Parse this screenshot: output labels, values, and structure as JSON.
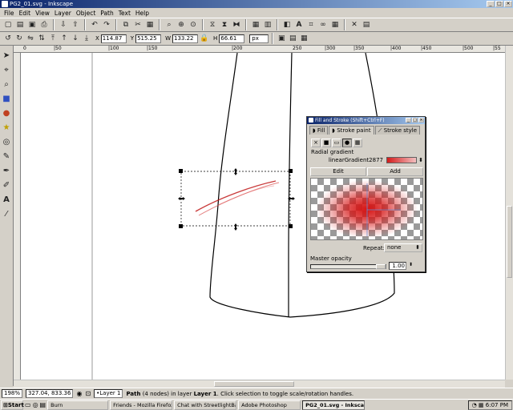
{
  "window": {
    "title": "PG2_01.svg - Inkscape"
  },
  "menu": [
    "File",
    "Edit",
    "View",
    "Layer",
    "Object",
    "Path",
    "Text",
    "Help"
  ],
  "toolbar": {
    "x_label": "X",
    "x_value": "114.87",
    "y_label": "Y",
    "y_value": "515.25",
    "w_label": "W",
    "w_value": "133.22",
    "h_label": "H",
    "h_value": "66.61",
    "unit": "px"
  },
  "ruler": {
    "h_marks": [
      "0",
      "|50",
      "|100",
      "|150",
      "|200",
      "250",
      "|300",
      "|350",
      "|400",
      "|450",
      "|500",
      "|55"
    ]
  },
  "dialog": {
    "title": "Fill and Stroke (Shift+Ctrl+F)",
    "tabs": [
      "Fill",
      "Stroke paint",
      "Stroke style"
    ],
    "gradient_type_label": "Radial gradient",
    "gradient_name": "linearGradient2877",
    "edit_label": "Edit",
    "add_label": "Add",
    "repeat_label": "Repeat:",
    "repeat_value": "none",
    "master_opacity_label": "Master opacity",
    "opacity_value": "1.00"
  },
  "status": {
    "zoom": "198%",
    "coords": "327.04, 833.36",
    "layer": "•Layer 1",
    "message_prefix": "Path",
    "message_mid": " (4 nodes) in layer ",
    "message_layer": "Layer 1",
    "message_suffix": ". Click selection to toggle scale/rotation handles."
  },
  "taskbar": {
    "start": "Start",
    "items": [
      "Burn",
      "Friends - Mozilla Firefox",
      "Chat with StreetlightBat...",
      "Adobe Photoshop",
      "PG2_01.svg - Inkscape"
    ],
    "active_index": 4,
    "clock": "6:07 PM"
  },
  "colors": {
    "gradient_red": "#d41b1b",
    "titlebar": "#0a246a"
  }
}
